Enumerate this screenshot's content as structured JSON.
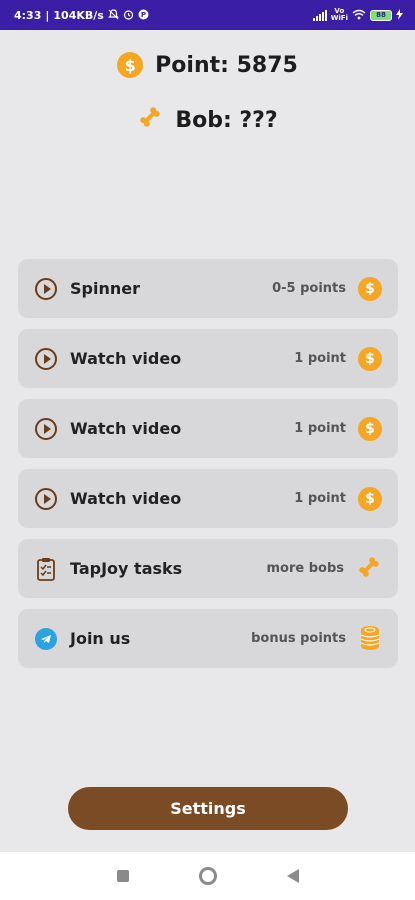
{
  "status_bar": {
    "time": "4:33",
    "net_speed": "104KB/s",
    "vowifi_top": "Vo",
    "vowifi_bottom": "WiFi",
    "battery": "88"
  },
  "header": {
    "points_label": "Point: 5875",
    "bob_label": "Bob: ???"
  },
  "tasks": [
    {
      "label": "Spinner",
      "reward": "0-5 points",
      "reward_icon": "coin-icon",
      "lead_icon": "play-circle-icon"
    },
    {
      "label": "Watch video",
      "reward": "1 point",
      "reward_icon": "coin-icon",
      "lead_icon": "play-circle-icon"
    },
    {
      "label": "Watch video",
      "reward": "1 point",
      "reward_icon": "coin-icon",
      "lead_icon": "play-circle-icon"
    },
    {
      "label": "Watch video",
      "reward": "1 point",
      "reward_icon": "coin-icon",
      "lead_icon": "play-circle-icon"
    },
    {
      "label": "TapJoy tasks",
      "reward": "more bobs",
      "reward_icon": "bone-icon",
      "lead_icon": "clipboard-icon"
    },
    {
      "label": "Join us",
      "reward": "bonus points",
      "reward_icon": "coin-stack-icon",
      "lead_icon": "telegram-icon"
    }
  ],
  "settings_button": {
    "label": "Settings"
  },
  "colors": {
    "accent_brown": "#7a4b25",
    "coin_orange": "#f5a623",
    "status_bar": "#3a1fa6"
  }
}
